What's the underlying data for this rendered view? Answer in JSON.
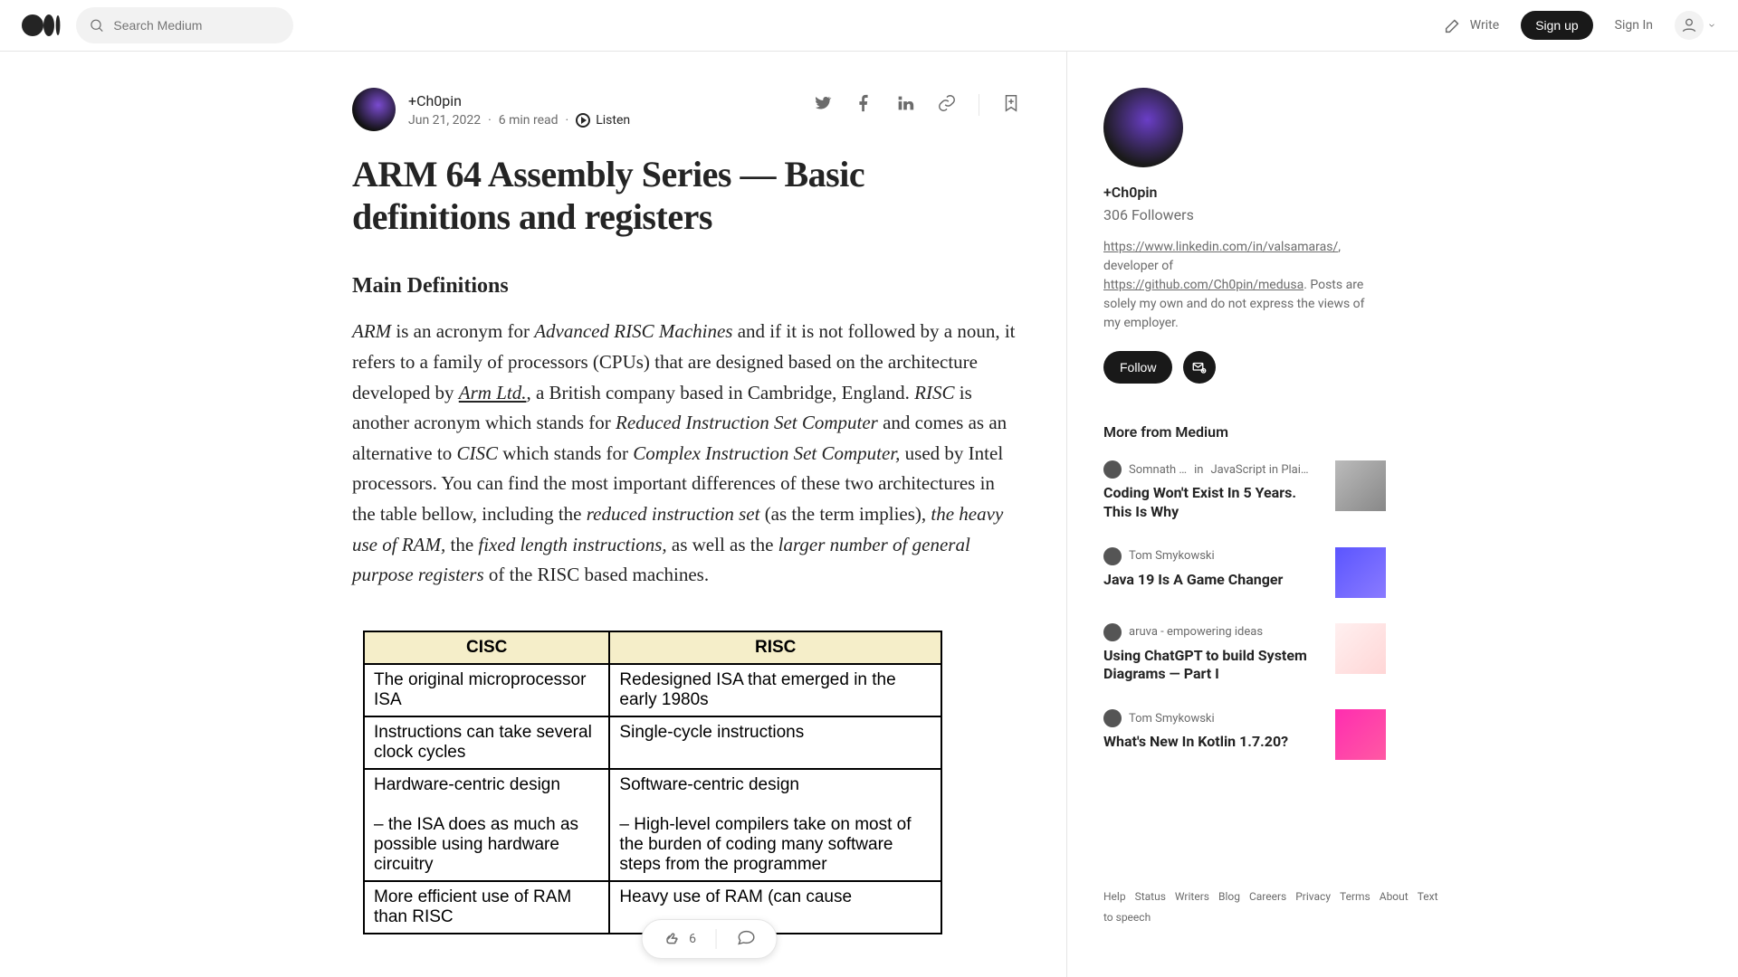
{
  "header": {
    "search_placeholder": "Search Medium",
    "write_label": "Write",
    "signup_label": "Sign up",
    "signin_label": "Sign In"
  },
  "post": {
    "author": "+Ch0pin",
    "date": "Jun 21, 2022",
    "read_time": "6 min read",
    "listen_label": "Listen",
    "title": "ARM 64 Assembly Series — Basic definitions and registers",
    "section_heading": "Main Definitions",
    "body_html": "<span class='it'>ARM</span> is an acronym for <span class='it'>Advanced RISC Machines</span> and if it is not followed by a noun, it refers to a family of processors (CPUs) that are designed based on the architecture developed by <span class='lnk it'>Arm Ltd.</span>, a British company based in Cambridge, England. <span class='it'>RISC</span> is another acronym which stands for <span class='it'>Reduced Instruction Set Computer</span> and comes as an alternative to <span class='it'>CISC</span> which stands for <span class='it'>Complex Instruction Set Computer,</span> used by Intel processors. You can find the most important differences of these two architectures in the table bellow, including the <span class='it'>reduced instruction set</span> (as the term implies), <span class='it'>the heavy use of RAM,</span> the <span class='it'>fixed length instructions,</span> as well as the <span class='it'>larger number of general purpose registers</span> of the RISC based machines.",
    "table": {
      "head": [
        "CISC",
        "RISC"
      ],
      "rows": [
        [
          "The original microprocessor ISA",
          "Redesigned ISA that emerged in the early 1980s"
        ],
        [
          "Instructions can take several clock cycles",
          "Single-cycle instructions"
        ],
        [
          "Hardware-centric design\n\n– the ISA does as much as possible using hardware circuitry",
          "Software-centric design\n\n– High-level compilers take on most of the burden of coding many software steps from the programmer"
        ],
        [
          "More efficient use of RAM than RISC",
          "Heavy use of RAM (can cause"
        ]
      ]
    },
    "claps": "6"
  },
  "sidebar": {
    "name": "+Ch0pin",
    "followers": "306 Followers",
    "bio_link1": "https://www.linkedin.com/in/valsamaras/",
    "bio_mid": ", developer of ",
    "bio_link2": "https://github.com/Ch0pin/medusa",
    "bio_tail": ". Posts are solely my own and do not express the views of my employer.",
    "follow_label": "Follow",
    "more_heading": "More from Medium",
    "recs": [
      {
        "author": "Somnath …",
        "in": "in",
        "pub": "JavaScript in Plai…",
        "title": "Coding Won't Exist In 5 Years. This Is Why"
      },
      {
        "author": "Tom Smykowski",
        "in": "",
        "pub": "",
        "title": "Java 19 Is A Game Changer"
      },
      {
        "author": "aruva - empowering ideas",
        "in": "",
        "pub": "",
        "title": "Using ChatGPT to build System Diagrams — Part I"
      },
      {
        "author": "Tom Smykowski",
        "in": "",
        "pub": "",
        "title": "What's New In Kotlin 1.7.20?"
      }
    ]
  },
  "footer": {
    "links": [
      "Help",
      "Status",
      "Writers",
      "Blog",
      "Careers",
      "Privacy",
      "Terms",
      "About",
      "Text to speech"
    ]
  }
}
